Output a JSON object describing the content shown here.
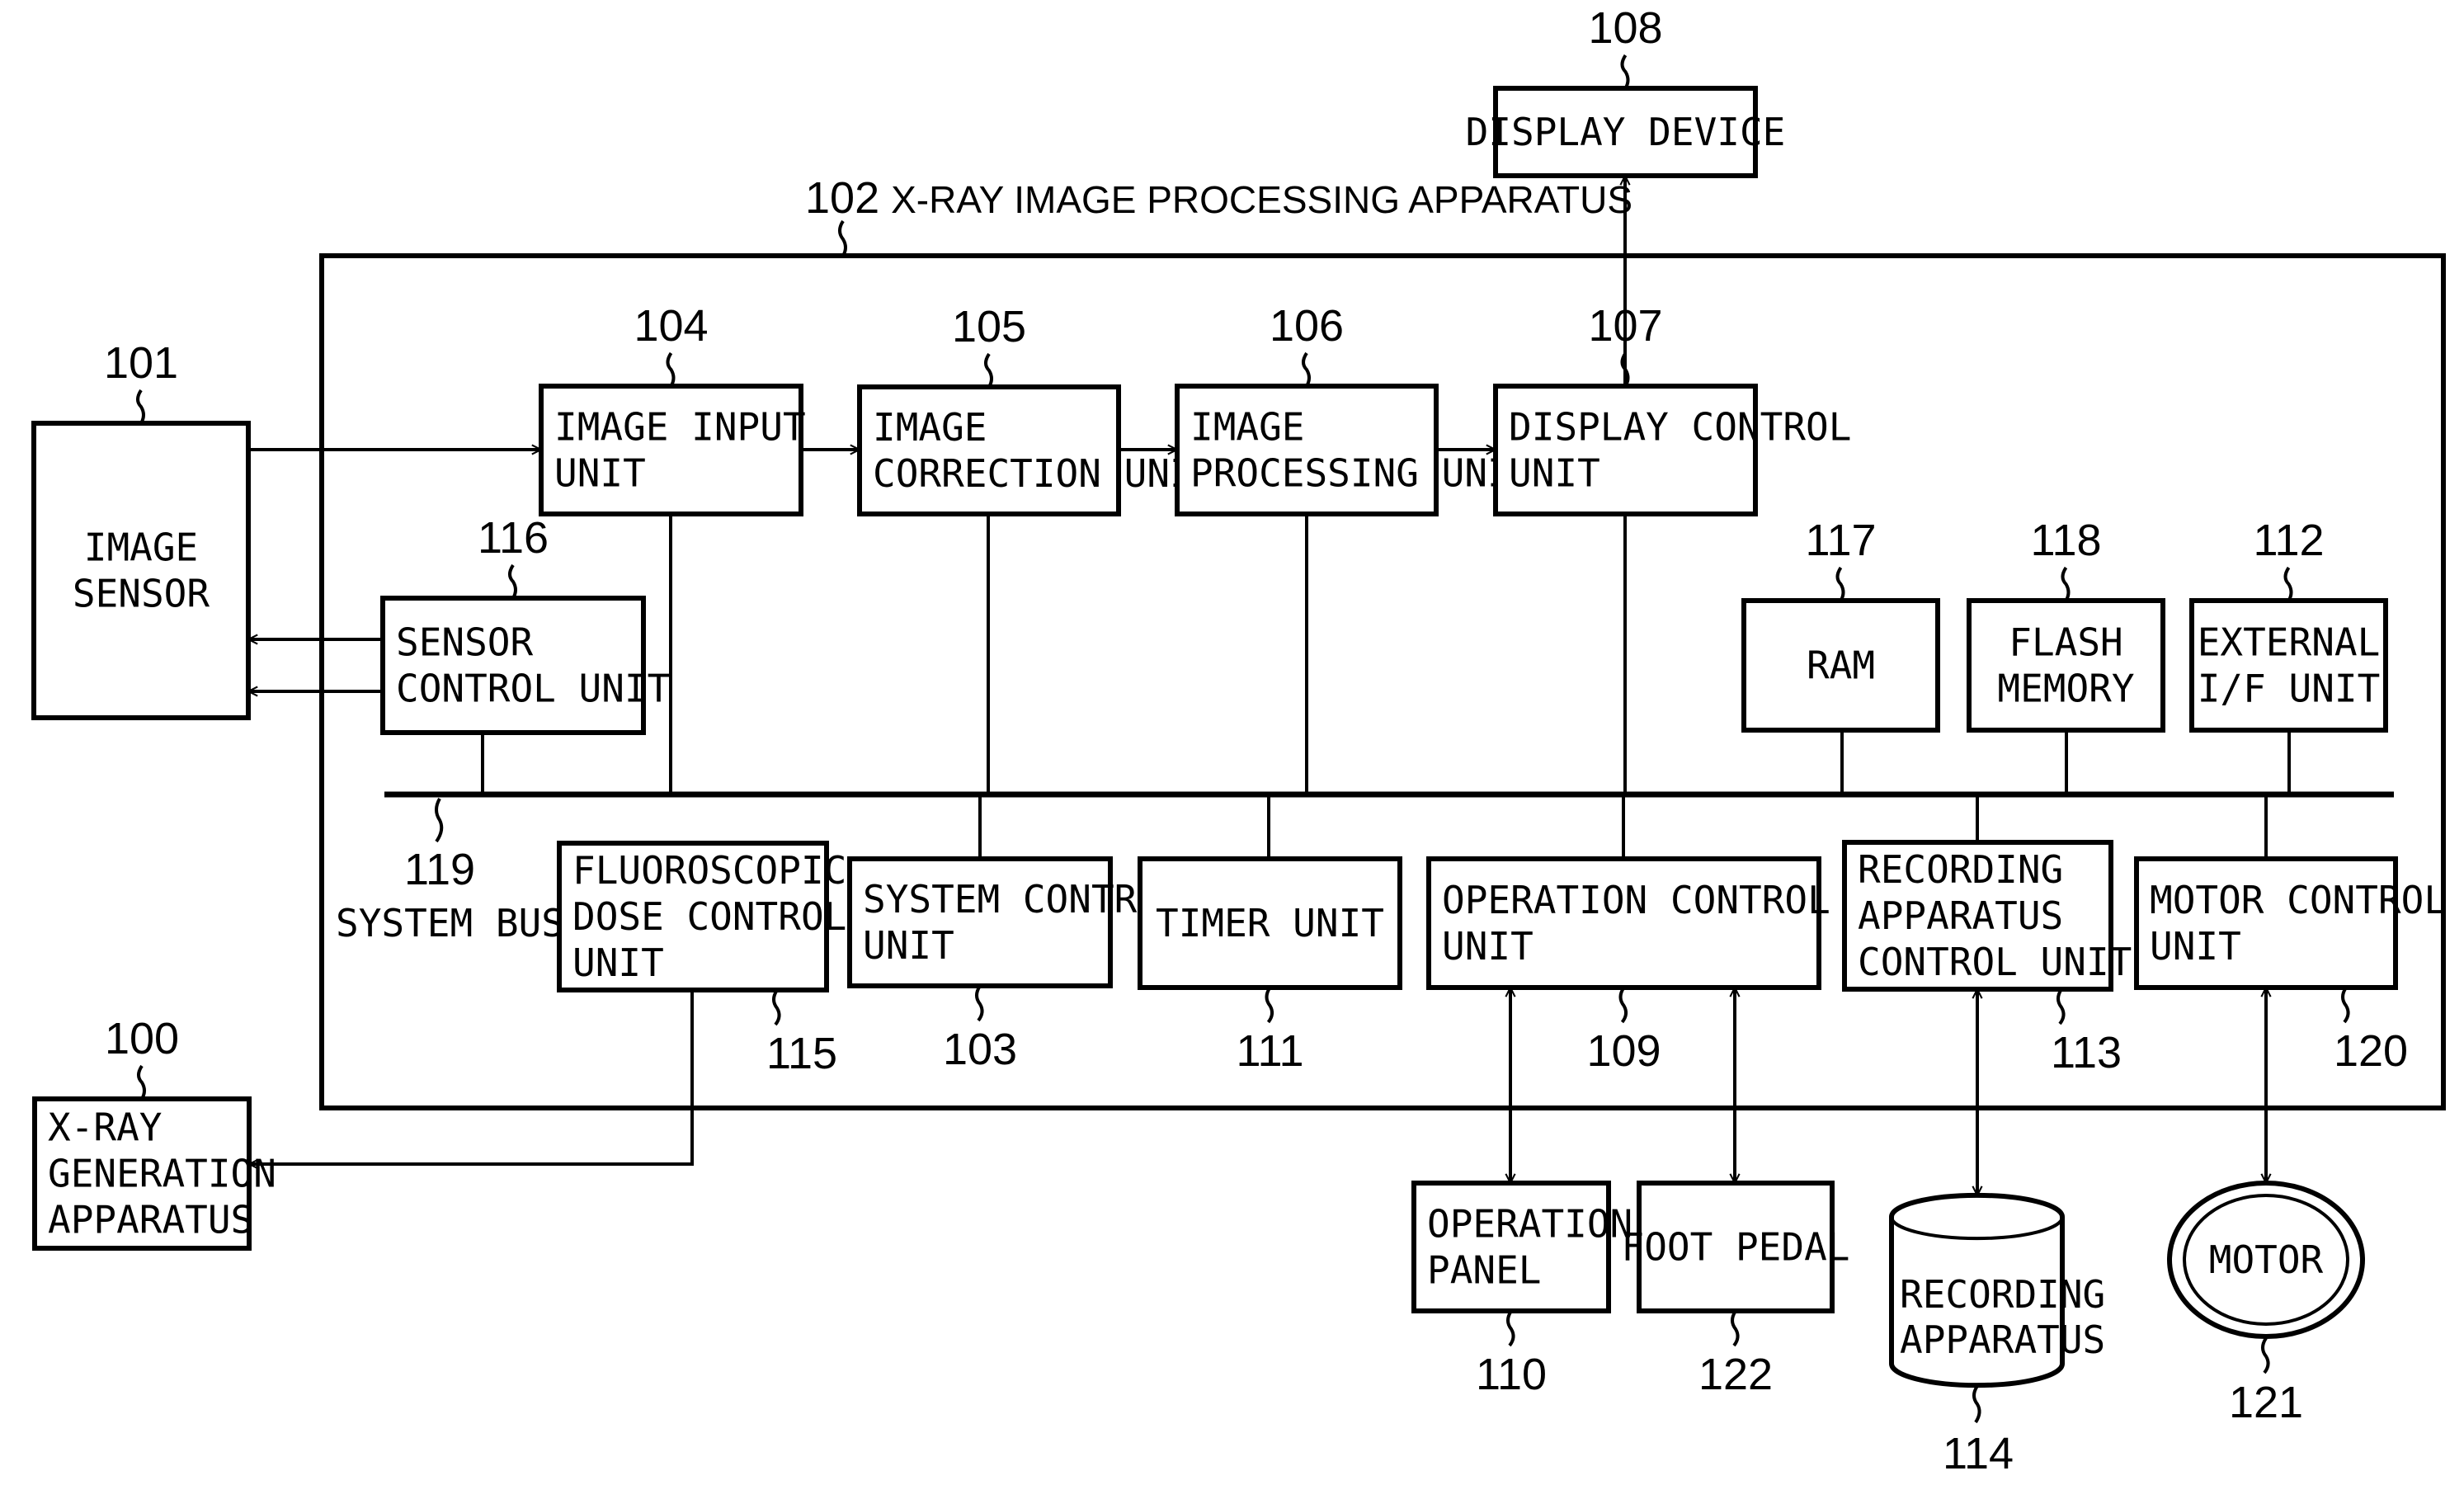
{
  "title": {
    "ref": "102",
    "text": "X-RAY IMAGE PROCESSING  APPARATUS"
  },
  "components": {
    "image_sensor": {
      "ref": "101",
      "lines": [
        "IMAGE",
        "SENSOR"
      ]
    },
    "image_input": {
      "ref": "104",
      "lines": [
        "IMAGE INPUT",
        "UNIT"
      ]
    },
    "image_correction": {
      "ref": "105",
      "lines": [
        "IMAGE",
        "CORRECTION UNIT"
      ]
    },
    "image_processing": {
      "ref": "106",
      "lines": [
        "IMAGE",
        "PROCESSING UNIT"
      ]
    },
    "display_control": {
      "ref": "107",
      "lines": [
        "DISPLAY CONTROL",
        "UNIT"
      ]
    },
    "display_device": {
      "ref": "108",
      "lines": [
        "DISPLAY DEVICE"
      ]
    },
    "sensor_control": {
      "ref": "116",
      "lines": [
        "SENSOR",
        "CONTROL UNIT"
      ]
    },
    "ram": {
      "ref": "117",
      "lines": [
        "RAM"
      ]
    },
    "flash_memory": {
      "ref": "118",
      "lines": [
        "FLASH",
        "MEMORY"
      ]
    },
    "external_if": {
      "ref": "112",
      "lines": [
        "EXTERNAL",
        "I/F UNIT"
      ]
    },
    "system_bus": {
      "ref": "119",
      "label": "SYSTEM BUS"
    },
    "fluoroscopic_dose": {
      "ref": "115",
      "lines": [
        "FLUOROSCOPIC",
        "DOSE CONTROL",
        "UNIT"
      ]
    },
    "system_control": {
      "ref": "103",
      "lines": [
        "SYSTEM CONTROL",
        "UNIT"
      ]
    },
    "timer": {
      "ref": "111",
      "lines": [
        "TIMER UNIT"
      ]
    },
    "operation_control": {
      "ref": "109",
      "lines": [
        "OPERATION CONTROL",
        "UNIT"
      ]
    },
    "recording_control": {
      "ref": "113",
      "lines": [
        "RECORDING",
        "APPARATUS",
        "CONTROL UNIT"
      ]
    },
    "motor_control": {
      "ref": "120",
      "lines": [
        "MOTOR CONTROL",
        "UNIT"
      ]
    },
    "xray_generation": {
      "ref": "100",
      "lines": [
        "X-RAY",
        "GENERATION",
        "APPARATUS"
      ]
    },
    "operation_panel": {
      "ref": "110",
      "lines": [
        "OPERATION",
        "PANEL"
      ]
    },
    "foot_pedal": {
      "ref": "122",
      "lines": [
        "FOOT PEDAL"
      ]
    },
    "recording_apparatus": {
      "ref": "114",
      "lines": [
        "RECORDING",
        "APPARATUS"
      ]
    },
    "motor": {
      "ref": "121",
      "lines": [
        "MOTOR"
      ]
    }
  }
}
